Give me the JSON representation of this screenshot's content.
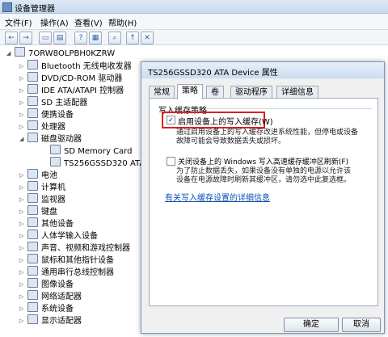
{
  "window": {
    "title": "设备管理器"
  },
  "menu": [
    "文件(F)",
    "操作(A)",
    "查看(V)",
    "帮助(H)"
  ],
  "toolbar": {
    "back": "←",
    "forward": "→"
  },
  "tree": {
    "root": "7ORW8OLPBH0KZRW",
    "items": [
      "Bluetooth 无线电收发器",
      "DVD/CD-ROM 驱动器",
      "IDE ATA/ATAPI 控制器",
      "SD 主适配器",
      "便携设备",
      "处理器",
      "磁盘驱动器",
      "SD Memory Card",
      "TS256GSSD320 ATA Device",
      "电池",
      "计算机",
      "监视器",
      "键盘",
      "其他设备",
      "人体学输入设备",
      "声音、视频和游戏控制器",
      "鼠标和其他指针设备",
      "通用串行总线控制器",
      "图像设备",
      "网络适配器",
      "系统设备",
      "显示适配器"
    ]
  },
  "dialog": {
    "title": "TS256GSSD320 ATA Device 属性",
    "tabs": [
      "常规",
      "策略",
      "卷",
      "驱动程序",
      "详细信息"
    ],
    "group_label": "写入缓存策略",
    "option1": {
      "label": "启用设备上的写入缓存(W)",
      "checked": "✓",
      "desc1": "通过启用设备上的写入缓存改进系统性能，但停电或设备",
      "desc2": "故障可能会导致数据丢失或损坏。"
    },
    "option2": {
      "label": "关闭设备上的 Windows 写入高速缓存缓冲区刷新(F)",
      "desc1": "为了防止数据丢失，如果设备没有单独的电源以允许该",
      "desc2": "设备在电源故障时刷新其缓冲区，请勿选中此复选框。"
    },
    "link": "有关写入缓存设置的详细信息",
    "ok": "确定",
    "cancel": "取消"
  },
  "colors": {
    "highlight": "#e02020",
    "link": "#0a4fb5"
  }
}
